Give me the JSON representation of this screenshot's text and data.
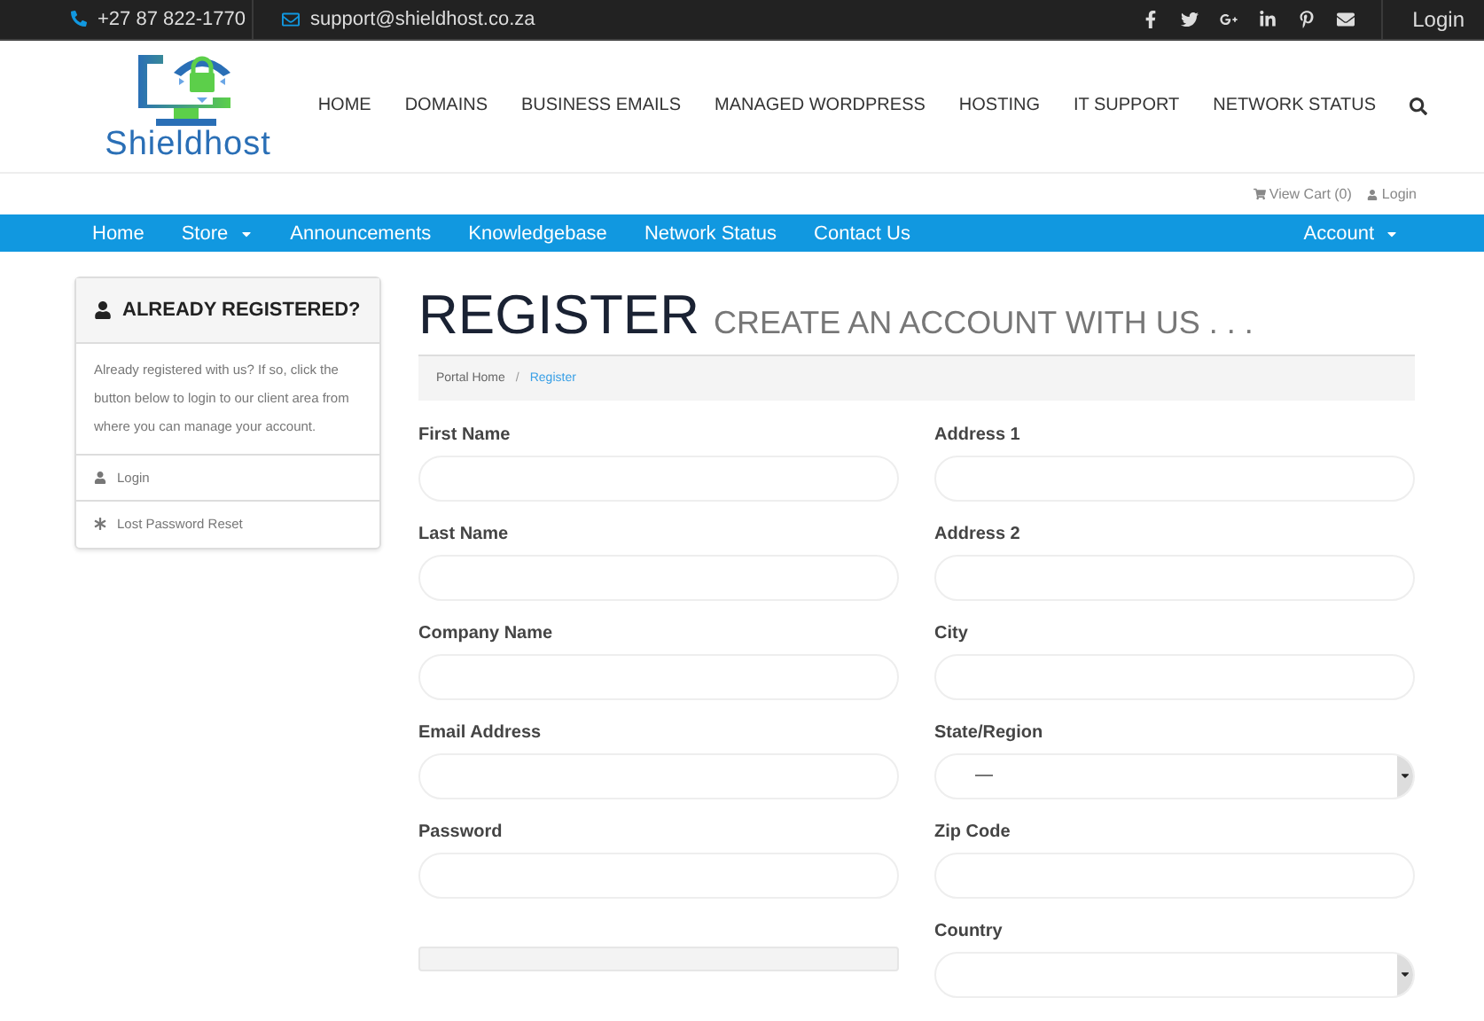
{
  "topbar": {
    "phone": "+27 87 822-1770",
    "email": "support@shieldhost.co.za",
    "login": "Login"
  },
  "header": {
    "logo_text": "Shieldhost",
    "menu": [
      "HOME",
      "DOMAINS",
      "BUSINESS EMAILS",
      "MANAGED WORDPRESS",
      "HOSTING",
      "IT SUPPORT",
      "NETWORK STATUS"
    ]
  },
  "cart_strip": {
    "cart": "View Cart (0)",
    "login": "Login"
  },
  "navbar": {
    "items": [
      {
        "label": "Home",
        "dropdown": false
      },
      {
        "label": "Store",
        "dropdown": true
      },
      {
        "label": "Announcements",
        "dropdown": false
      },
      {
        "label": "Knowledgebase",
        "dropdown": false
      },
      {
        "label": "Network Status",
        "dropdown": false
      },
      {
        "label": "Contact Us",
        "dropdown": false
      }
    ],
    "account": {
      "label": "Account",
      "dropdown": true
    }
  },
  "sidebar": {
    "title": "ALREADY REGISTERED?",
    "text": "Already registered with us? If so, click the button below to login to our client area from where you can manage your account.",
    "links": [
      {
        "label": "Login",
        "kind": "user"
      },
      {
        "label": "Lost Password Reset",
        "kind": "asterisk"
      }
    ]
  },
  "page": {
    "title": "REGISTER",
    "subtitle": "CREATE AN ACCOUNT WITH US . . .",
    "breadcrumb_separator": "/",
    "breadcrumb": [
      {
        "label": "Portal Home",
        "selected": false
      },
      {
        "label": "Register",
        "selected": true
      }
    ]
  },
  "form": {
    "left": [
      {
        "kind": "text",
        "label": "First Name"
      },
      {
        "kind": "text",
        "label": "Last Name"
      },
      {
        "kind": "text",
        "label": "Company Name"
      },
      {
        "kind": "text",
        "label": "Email Address"
      },
      {
        "kind": "text",
        "label": "Password"
      },
      {
        "kind": "meter",
        "level": 0
      }
    ],
    "right": [
      {
        "kind": "text",
        "label": "Address 1"
      },
      {
        "kind": "text",
        "label": "Address 2"
      },
      {
        "kind": "text",
        "label": "City"
      },
      {
        "kind": "select",
        "label": "State/Region",
        "value": "—"
      },
      {
        "kind": "text",
        "label": "Zip Code"
      },
      {
        "kind": "select",
        "label": "Country"
      }
    ]
  }
}
